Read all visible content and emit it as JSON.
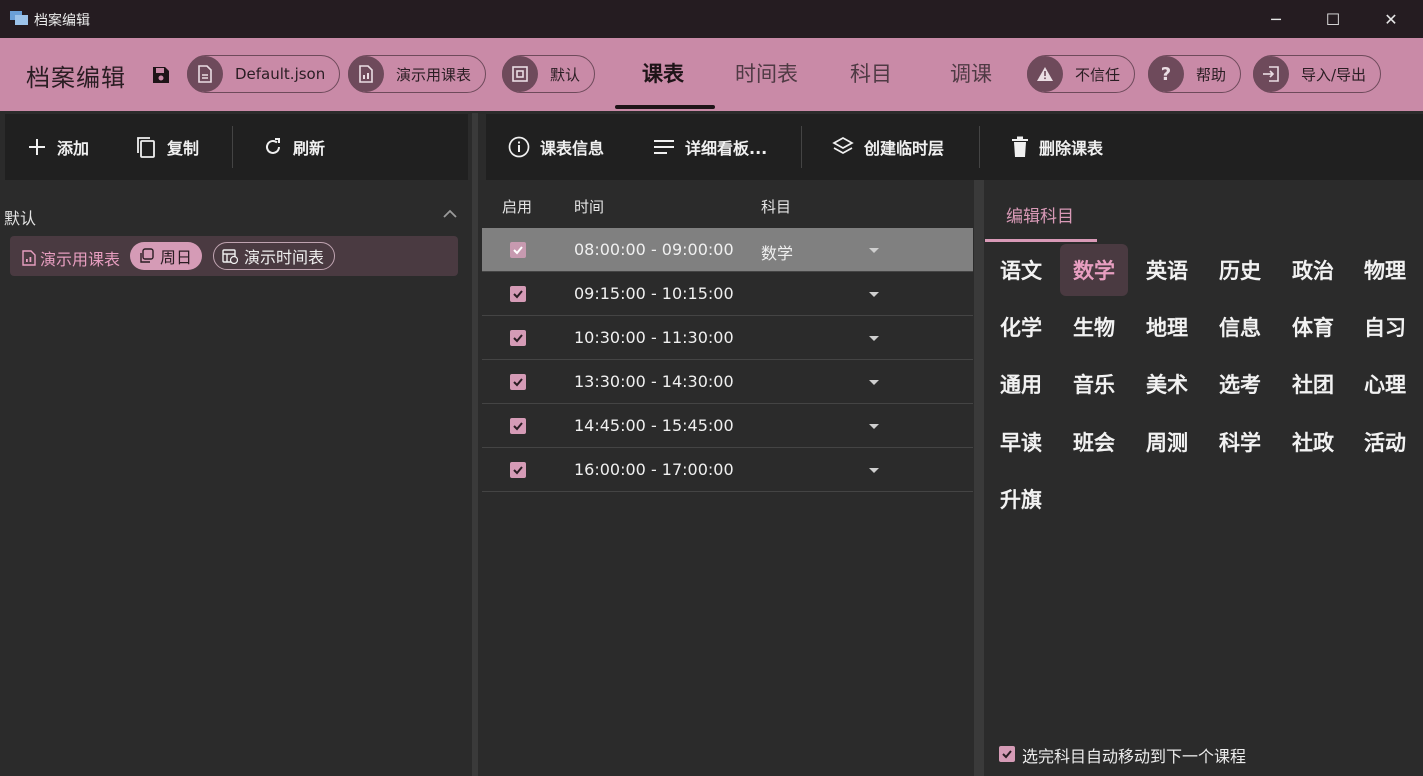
{
  "window": {
    "title": "档案编辑",
    "min": "─",
    "max": "☐",
    "close": "✕"
  },
  "header": {
    "title": "档案编辑",
    "file_pill": "Default.json",
    "schedule_pill": "演示用课表",
    "layer_pill": "默认",
    "tabs": [
      "课表",
      "时间表",
      "科目",
      "调课"
    ],
    "untrusted_pill": "不信任",
    "help_pill": "帮助",
    "import_export_pill": "导入/导出"
  },
  "left_toolbar": {
    "add": "添加",
    "copy": "复制",
    "refresh": "刷新"
  },
  "left_panel": {
    "group": "默认",
    "item_name": "演示用课表",
    "item_day": "周日",
    "item_timetable": "演示时间表"
  },
  "mid_toolbar": {
    "info": "课表信息",
    "details": "详细看板...",
    "temp_layer": "创建临时层",
    "delete": "删除课表"
  },
  "table": {
    "headers": [
      "启用",
      "时间",
      "科目"
    ],
    "rows": [
      {
        "time": "08:00:00 - 09:00:00",
        "subject": "数学"
      },
      {
        "time": "09:15:00 - 10:15:00",
        "subject": ""
      },
      {
        "time": "10:30:00 - 11:30:00",
        "subject": ""
      },
      {
        "time": "13:30:00 - 14:30:00",
        "subject": ""
      },
      {
        "time": "14:45:00 - 15:45:00",
        "subject": ""
      },
      {
        "time": "16:00:00 - 17:00:00",
        "subject": ""
      }
    ]
  },
  "right_panel": {
    "tab": "编辑科目",
    "subjects": [
      "语文",
      "数学",
      "英语",
      "历史",
      "政治",
      "物理",
      "化学",
      "生物",
      "地理",
      "信息",
      "体育",
      "自习",
      "通用",
      "音乐",
      "美术",
      "选考",
      "社团",
      "心理",
      "早读",
      "班会",
      "周测",
      "科学",
      "社政",
      "活动",
      "升旗"
    ],
    "selected": "数学",
    "auto_move": "选完科目自动移动到下一个课程"
  },
  "colors": {
    "accent": "#c98aa7",
    "pink_text": "#e79ec0",
    "dark": "#202020"
  }
}
